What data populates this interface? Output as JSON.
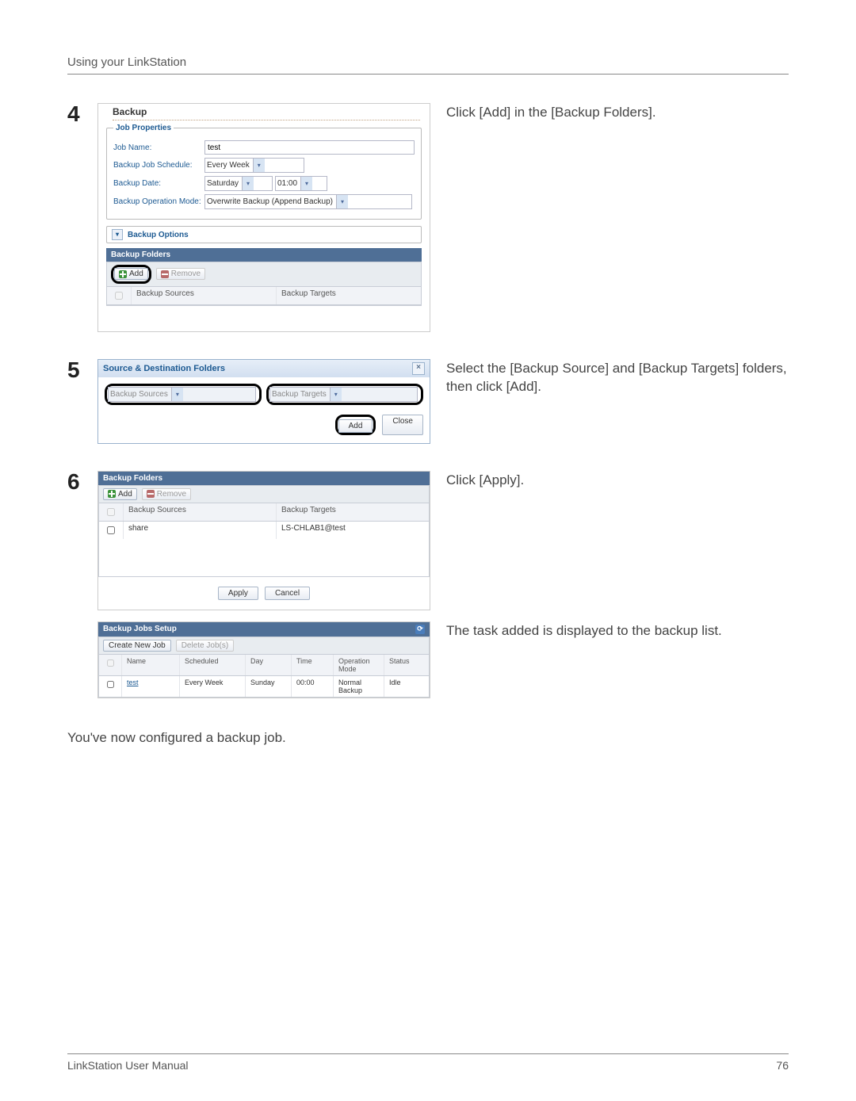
{
  "header": {
    "chapter": "Using your LinkStation"
  },
  "footer": {
    "manual": "LinkStation User Manual",
    "page": "76"
  },
  "closing": "You've now configured a backup job.",
  "step4": {
    "num": "4",
    "desc": "Click [Add] in the [Backup Folders].",
    "title": "Backup",
    "jobPropsLegend": "Job Properties",
    "jobNameLabel": "Job Name:",
    "jobNameValue": "test",
    "scheduleLabel": "Backup Job Schedule:",
    "scheduleValue": "Every Week",
    "dateLabel": "Backup Date:",
    "day": "Saturday",
    "time": "01:00",
    "modeLabel": "Backup Operation Mode:",
    "modeValue": "Overwrite Backup (Append Backup)",
    "optionsLabel": "Backup Options",
    "foldersHeader": "Backup Folders",
    "addBtn": "Add",
    "removeBtn": "Remove",
    "colSources": "Backup Sources",
    "colTargets": "Backup Targets"
  },
  "step5": {
    "num": "5",
    "desc": "Select the [Backup Source] and [Backup Targets] folders, then click [Add].",
    "dialogTitle": "Source & Destination Folders",
    "srcPlaceholder": "Backup Sources",
    "tgtPlaceholder": "Backup Targets",
    "addBtn": "Add",
    "closeBtn": "Close"
  },
  "step6": {
    "num": "6",
    "desc": "Click [Apply].",
    "foldersHeader": "Backup Folders",
    "addBtn": "Add",
    "removeBtn": "Remove",
    "colSources": "Backup Sources",
    "colTargets": "Backup Targets",
    "rowSrc": "share",
    "rowTgt": "LS-CHLAB1@test",
    "applyBtn": "Apply",
    "cancelBtn": "Cancel"
  },
  "jobs": {
    "desc": "The task added is displayed to the backup list.",
    "title": "Backup Jobs Setup",
    "createBtn": "Create New Job",
    "deleteBtn": "Delete Job(s)",
    "colName": "Name",
    "colScheduled": "Scheduled",
    "colDay": "Day",
    "colTime": "Time",
    "colMode": "Operation Mode",
    "colStatus": "Status",
    "rowName": "test",
    "rowScheduled": "Every Week",
    "rowDay": "Sunday",
    "rowTime": "00:00",
    "rowMode": "Normal Backup",
    "rowStatus": "Idle"
  },
  "chart_data": null
}
